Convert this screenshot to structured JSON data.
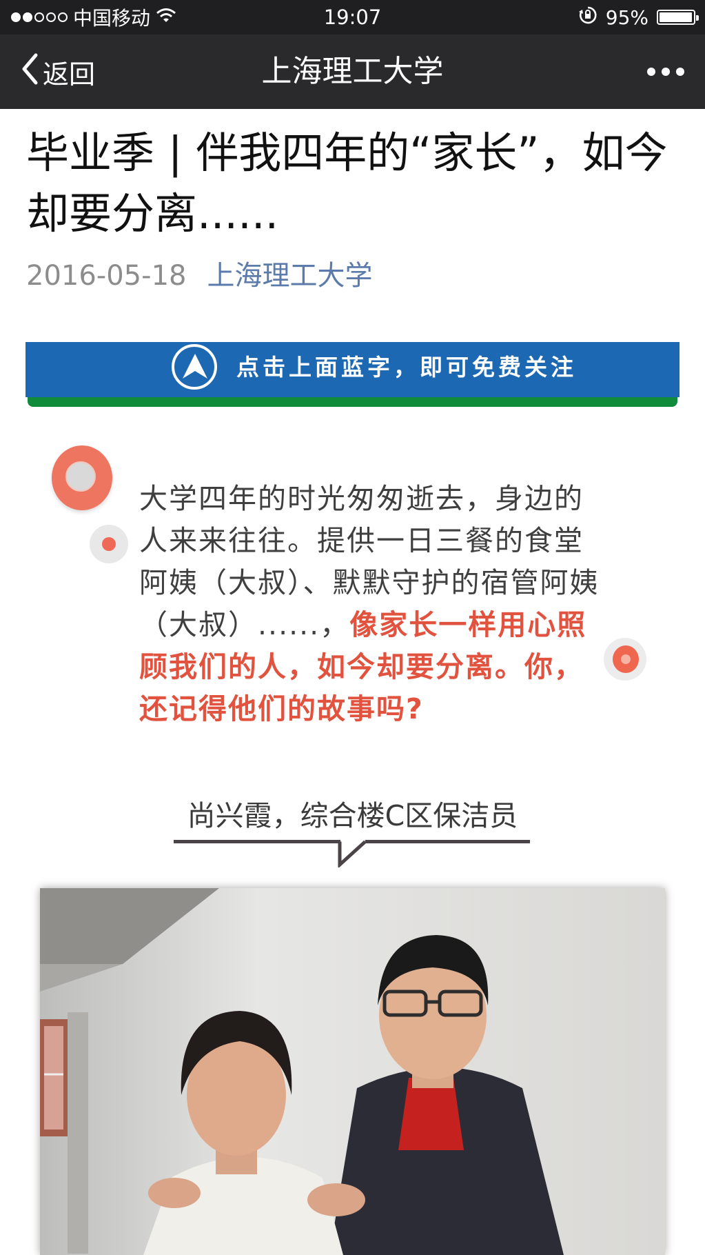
{
  "status_bar": {
    "carrier": "中国移动",
    "time": "19:07",
    "battery": "95%",
    "battery_level": 0.95,
    "signal_bars": 2
  },
  "nav": {
    "back_label": "返回",
    "title": "上海理工大学",
    "more_icon": "more-dots-icon"
  },
  "article": {
    "title": "毕业季 | 伴我四年的“家长”，如今却要分离......",
    "date": "2016-05-18",
    "account": "上海理工大学"
  },
  "banner": {
    "text": "点击上面蓝字，即可免费关注",
    "colors": {
      "bg": "#1d68b2",
      "stripe": "#0f8b3a"
    }
  },
  "intro": {
    "text_plain": "大学四年的时光匆匆逝去，身边的人来来往往。提供一日三餐的食堂阿姨（大叔）、默默守护的宿管阿姨（大叔）......，",
    "text_highlight": "像家长一样用心照顾我们的人，如今却要分离。你，还记得他们的故事吗?",
    "highlight_color": "#e2533f"
  },
  "section": {
    "caption": "尚兴霞，综合楼C区保洁员"
  }
}
